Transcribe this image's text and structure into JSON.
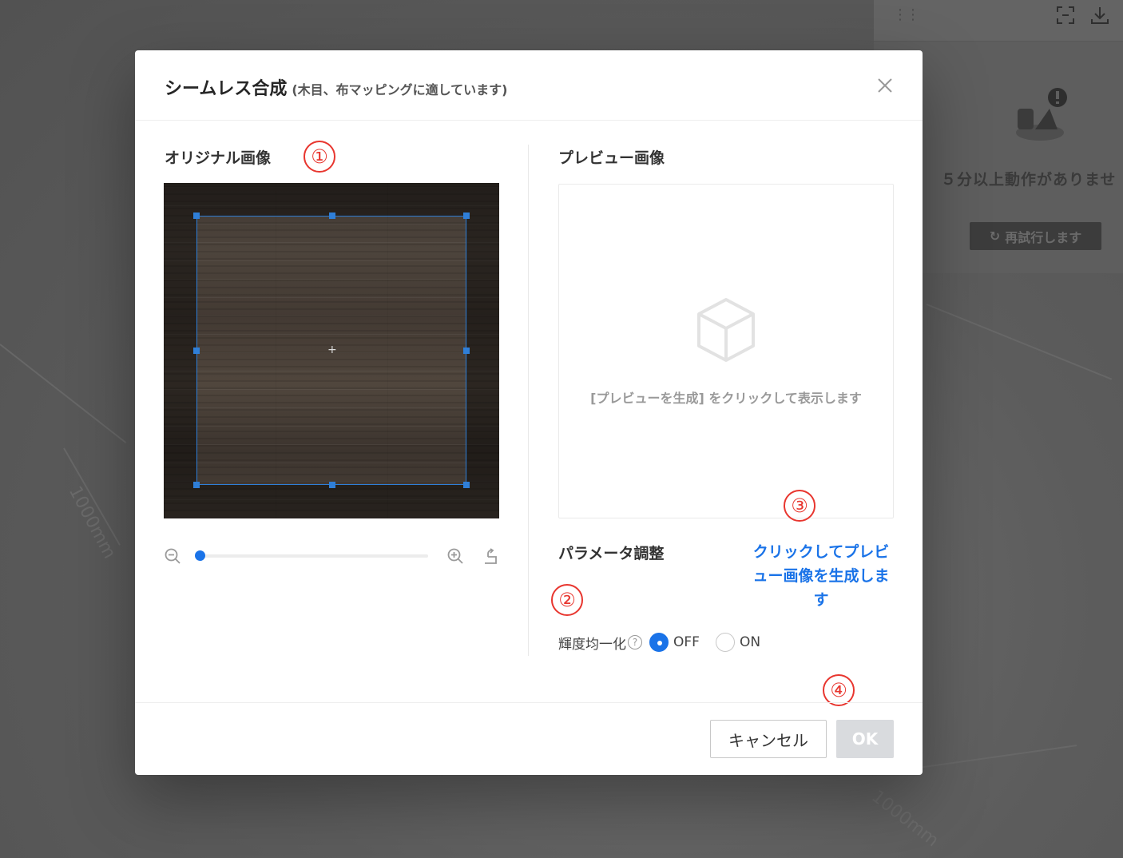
{
  "background": {
    "panel": {
      "message": "５分以上動作がありませ",
      "retry_label": "再試行します",
      "fullscreen_icon": "fullscreen-icon",
      "download_icon": "download-icon"
    },
    "dimension_labels": [
      "1000mm",
      "1000mm"
    ]
  },
  "dialog": {
    "title": "シームレス合成",
    "subtitle": "(木目、布マッピングに適しています)",
    "close_icon": "close-icon",
    "original": {
      "title": "オリジナル画像",
      "zoom_level": 0.02
    },
    "preview": {
      "title": "プレビュー画像",
      "hint": "[プレビューを生成] をクリックして表示します",
      "generate_link": "クリックしてプレビュー画像を生成します"
    },
    "params": {
      "title": "パラメータ調整",
      "brightness_label": "輝度均一化",
      "help": "?",
      "options": [
        {
          "label": "OFF",
          "selected": true
        },
        {
          "label": "ON",
          "selected": false
        }
      ]
    },
    "footer": {
      "cancel_label": "キャンセル",
      "ok_label": "OK"
    },
    "annotations": [
      "①",
      "②",
      "③",
      "④"
    ]
  },
  "colors": {
    "accent": "#1a73e8",
    "annotation": "#e8362f",
    "ok_disabled": "#d9dbde"
  }
}
